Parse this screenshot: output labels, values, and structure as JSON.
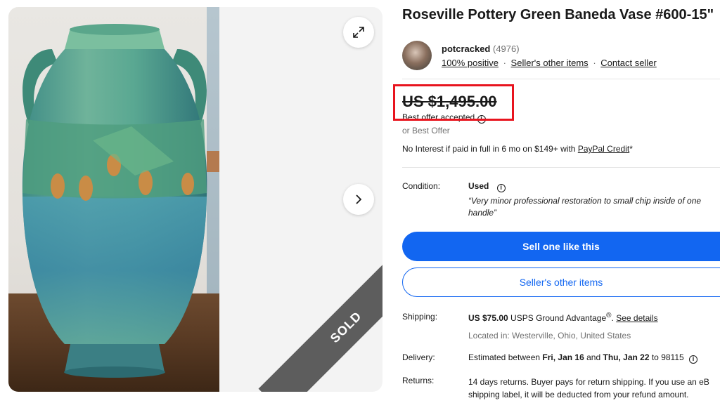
{
  "listing": {
    "title": "Roseville Pottery Green Baneda Vase #600-15\"",
    "sold_label": "SOLD"
  },
  "seller": {
    "name": "potcracked",
    "feedback_count": "(4976)",
    "positive": "100% positive",
    "other_items_link": "Seller's other items",
    "contact_link": "Contact seller",
    "separator": "·"
  },
  "price": {
    "amount": "US $1,495.00",
    "offer_note": "Best offer accepted",
    "or_best_offer": "or Best Offer",
    "financing_text": "No Interest if paid in full in 6 mo on $149+ with ",
    "financing_link": "PayPal Credit",
    "financing_suffix": "*"
  },
  "condition": {
    "label": "Condition:",
    "value": "Used",
    "quote": "“Very minor professional restoration to small chip inside of one handle”"
  },
  "actions": {
    "sell_one": "Sell one like this",
    "seller_items": "Seller's other items"
  },
  "shipping": {
    "label": "Shipping:",
    "cost": "US $75.00",
    "service": " USPS Ground Advantage",
    "registered": "®",
    "dot": ". ",
    "details_link": "See details",
    "located": "Located in: Westerville, Ohio, United States"
  },
  "delivery": {
    "label": "Delivery:",
    "prefix": "Estimated between ",
    "start": "Fri, Jan 16",
    "middle": " and ",
    "end": "Thu, Jan 22",
    "suffix": " to 98115"
  },
  "returns": {
    "label": "Returns:",
    "line1": "14 days returns. Buyer pays for return shipping. If you use an eB",
    "line2": "shipping label, it will be deducted from your refund amount."
  },
  "colors": {
    "primary_blue": "#1266f1",
    "highlight_red": "#e8141e",
    "sold_ribbon": "#5d5d5d"
  }
}
